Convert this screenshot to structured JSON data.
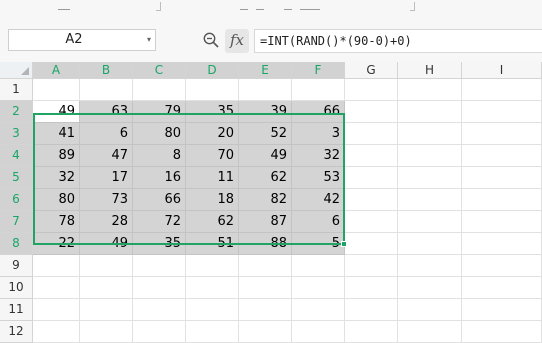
{
  "name_box": {
    "value": "A2",
    "caret": "▾"
  },
  "formula_bar": {
    "fx_label": "fx",
    "formula": "=INT(RAND()*(90-0)+0)"
  },
  "sheet": {
    "columns": [
      "A",
      "B",
      "C",
      "D",
      "E",
      "F",
      "G",
      "H",
      "I"
    ],
    "rows": [
      "1",
      "2",
      "3",
      "4",
      "5",
      "6",
      "7",
      "8",
      "9",
      "10",
      "11",
      "12"
    ],
    "selected_columns": [
      "A",
      "B",
      "C",
      "D",
      "E",
      "F"
    ],
    "selected_rows": [
      "2",
      "3",
      "4",
      "5",
      "6",
      "7",
      "8"
    ],
    "active_cell": "A2",
    "data_start_row": 2,
    "values": [
      [
        49,
        63,
        79,
        35,
        39,
        66
      ],
      [
        41,
        6,
        80,
        20,
        52,
        3
      ],
      [
        89,
        47,
        8,
        70,
        49,
        32
      ],
      [
        32,
        17,
        16,
        11,
        62,
        53
      ],
      [
        80,
        73,
        66,
        18,
        82,
        42
      ],
      [
        78,
        28,
        72,
        62,
        87,
        6
      ],
      [
        22,
        49,
        35,
        51,
        88,
        5
      ]
    ]
  },
  "colors": {
    "selection_border": "#21a366",
    "selected_header_text": "#18a667",
    "selected_fill": "#d4d4d4"
  },
  "icons": {
    "zoom": "magnifier-icon",
    "fx": "function-icon",
    "dropdown": "chevron-down-icon"
  }
}
